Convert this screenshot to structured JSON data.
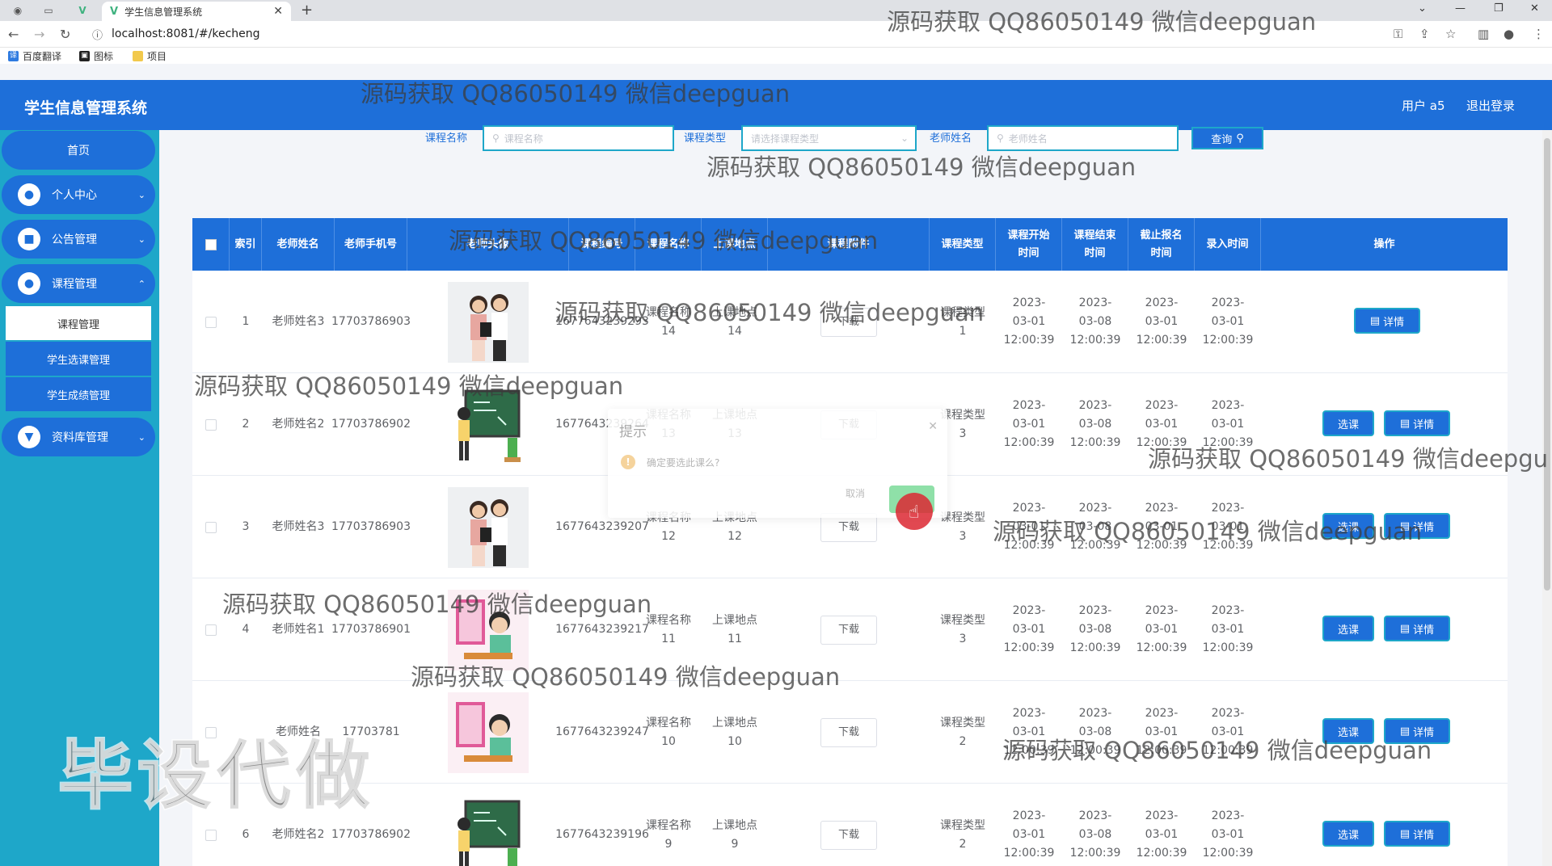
{
  "browser": {
    "tab_title": "学生信息管理系统",
    "url": "localhost:8081/#/kecheng",
    "bookmarks": [
      "百度翻译",
      "图标",
      "项目"
    ]
  },
  "header": {
    "app_title": "学生信息管理系统",
    "user": "用户 a5",
    "logout": "退出登录"
  },
  "sidebar": {
    "home": "首页",
    "items": [
      {
        "label": "个人中心"
      },
      {
        "label": "公告管理"
      },
      {
        "label": "课程管理"
      },
      {
        "label": "资料库管理"
      }
    ],
    "sub_items": [
      {
        "label": "课程管理"
      },
      {
        "label": "学生选课管理"
      },
      {
        "label": "学生成绩管理"
      }
    ]
  },
  "search": {
    "course_name_label": "课程名称",
    "course_name_placeholder": "课程名称",
    "course_type_label": "课程类型",
    "course_type_placeholder": "请选择课程类型",
    "teacher_label": "老师姓名",
    "teacher_placeholder": "老师姓名",
    "query_button": "查询"
  },
  "table": {
    "headers": [
      "索引",
      "老师姓名",
      "老师手机号",
      "老师头像",
      "课程编号",
      "课程名称",
      "上课地点",
      "课程附件",
      "课程类型",
      "课程开始时间",
      "课程结束时间",
      "截止报名时间",
      "录入时间",
      "操作"
    ],
    "download_label": "下载",
    "select_label": "选课",
    "details_label": "详情",
    "rows": [
      {
        "index": "1",
        "teacher": "老师姓名3",
        "phone": "17703786903",
        "code": "1677643239293",
        "name": "课程名称14",
        "place": "上课地点14",
        "type": "课程类型1",
        "start": "2023-03-01 12:00:39",
        "end": "2023-03-08 12:00:39",
        "deadline": "2023-03-01 12:00:39",
        "created": "2023-03-01 12:00:39",
        "avatar": "woman-teacher"
      },
      {
        "index": "2",
        "teacher": "老师姓名2",
        "phone": "17703786902",
        "code": "1677643239264",
        "name": "课程名称13",
        "place": "上课地点13",
        "type": "课程类型3",
        "start": "2023-03-01 12:00:39",
        "end": "2023-03-08 12:00:39",
        "deadline": "2023-03-01 12:00:39",
        "created": "2023-03-01 12:00:39",
        "avatar": "chalkboard-teacher"
      },
      {
        "index": "3",
        "teacher": "老师姓名3",
        "phone": "17703786903",
        "code": "1677643239207",
        "name": "课程名称12",
        "place": "上课地点12",
        "type": "课程类型3",
        "start": "2023-03-01 12:00:39",
        "end": "2023-03-08 12:00:39",
        "deadline": "2023-03-01 12:00:39",
        "created": "2023-03-01 12:00:39",
        "avatar": "woman-teacher"
      },
      {
        "index": "4",
        "teacher": "老师姓名1",
        "phone": "17703786901",
        "code": "1677643239217",
        "name": "课程名称11",
        "place": "上课地点11",
        "type": "课程类型3",
        "start": "2023-03-01 12:00:39",
        "end": "2023-03-08 12:00:39",
        "deadline": "2023-03-01 12:00:39",
        "created": "2023-03-01 12:00:39",
        "avatar": "poetry-teacher"
      },
      {
        "index": "",
        "teacher": "老师姓名",
        "phone": "17703781",
        "code": "1677643239247",
        "name": "课程名称10",
        "place": "上课地点10",
        "type": "课程类型2",
        "start": "2023-03-01 12:00:39",
        "end": "2023-03-08 12:00:39",
        "deadline": "2023-03-01 12:00:39",
        "created": "2023-03-01 12:00:39",
        "avatar": "poetry-teacher"
      },
      {
        "index": "6",
        "teacher": "老师姓名2",
        "phone": "17703786902",
        "code": "1677643239196",
        "name": "课程名称9",
        "place": "上课地点9",
        "type": "课程类型2",
        "start": "2023-03-01 12:00:39",
        "end": "2023-03-08 12:00:39",
        "deadline": "2023-03-01 12:00:39",
        "created": "2023-03-01 12:00:39",
        "avatar": "chalkboard-teacher"
      }
    ]
  },
  "dialog": {
    "title": "提示",
    "message": "确定要选此课么?",
    "cancel": "取消"
  },
  "watermarks": [
    "源码获取 QQ86050149 微信deepguan",
    "源码获取 QQ86050149 微信deepguan",
    "源码获取 QQ86050149 微信deepguan",
    "源码获取 QQ86050149 微信deepguan",
    "源码获取 QQ86050149 微信deepguan",
    "源码获取 QQ86050149 微信deepguan",
    "源码获取 QQ86050149 微信deepgu",
    "源码获取 QQ86050149 微信deepguan",
    "源码获取 QQ86050149 微信deepguan",
    "源码获取 QQ86050149 微信deepguan",
    "源码获取 QQ86050149 微信deepguan"
  ],
  "big_watermark": "毕设代做",
  "colors": {
    "primary": "#1e6fd9",
    "sidebar": "#1ea7c9",
    "accent_border": "#1ea7c9"
  }
}
